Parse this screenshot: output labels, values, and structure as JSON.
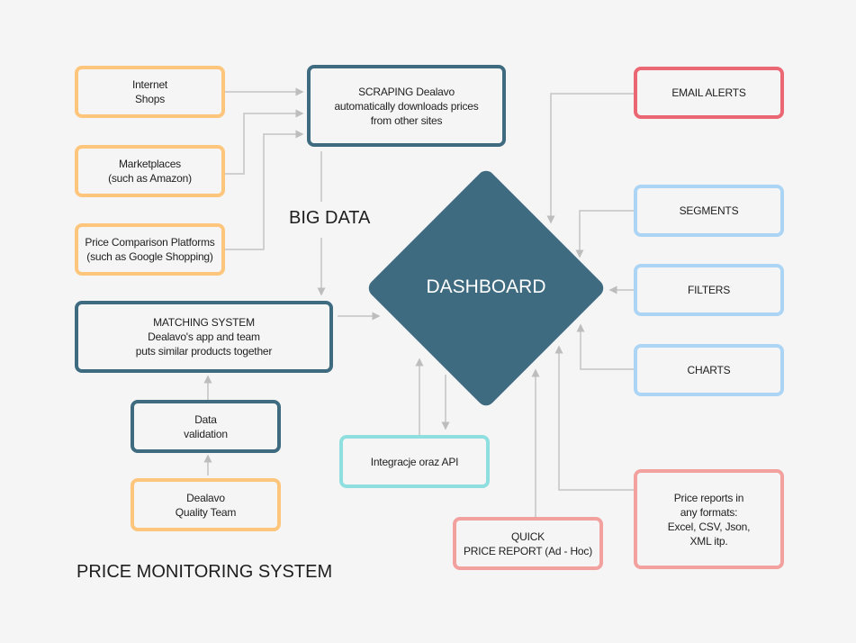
{
  "title": "PRICE MONITORING SYSTEM",
  "big_data_label": "BIG DATA",
  "dashboard_label": "DASHBOARD",
  "colors": {
    "background": "#f5f5f5",
    "dashboard": "#3f6b81",
    "source_border": "#fdc67c",
    "process_border": "#3f6b81",
    "alert_border": "#ec6774",
    "feature_border": "#acd5f5",
    "integration_border": "#8fdfe0",
    "report_border": "#f2a19e",
    "connector": "#bdbdbd"
  },
  "sources": [
    {
      "lines": [
        "Internet",
        "Shops"
      ]
    },
    {
      "lines": [
        "Marketplaces",
        "(such as Amazon)"
      ]
    },
    {
      "lines": [
        "Price Comparison Platforms",
        "(such as Google Shopping)"
      ]
    }
  ],
  "scraping": {
    "lines": [
      "SCRAPING Dealavo",
      "automatically downloads prices",
      "from other sites"
    ]
  },
  "matching": {
    "lines": [
      "MATCHING SYSTEM",
      "Dealavo's app and team",
      "puts similar products together"
    ]
  },
  "validation": {
    "lines": [
      "Data",
      "validation"
    ]
  },
  "quality_team": {
    "lines": [
      "Dealavo",
      "Quality Team"
    ]
  },
  "integration": {
    "lines": [
      "Integracje oraz API"
    ]
  },
  "quick_report": {
    "lines": [
      "QUICK",
      "PRICE REPORT (Ad - Hoc)"
    ]
  },
  "features": [
    {
      "label": "EMAIL ALERTS"
    },
    {
      "label": "SEGMENTS"
    },
    {
      "label": "FILTERS"
    },
    {
      "label": "CHARTS"
    }
  ],
  "reports": {
    "lines": [
      "Price reports in",
      "any formats:",
      "Excel, CSV, Json,",
      "XML itp."
    ]
  }
}
